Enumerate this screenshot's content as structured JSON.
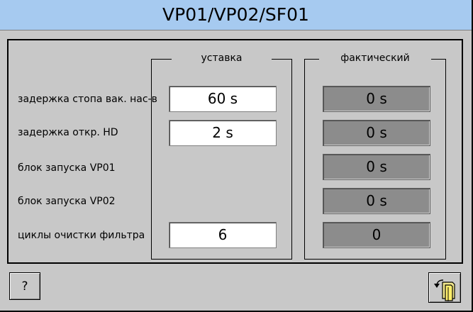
{
  "title": "VP01/VP02/SF01",
  "columns": {
    "setpoint": "уставка",
    "actual": "фактический"
  },
  "rows": [
    {
      "label": "задержка стопа вак. нас-в",
      "setpoint": "60 s",
      "actual": "0 s"
    },
    {
      "label": "задержка откр. HD",
      "setpoint": "2 s",
      "actual": "0 s"
    },
    {
      "label": "блок запуска VP01",
      "setpoint": null,
      "actual": "0 s"
    },
    {
      "label": "блок запуска VP02",
      "setpoint": null,
      "actual": "0 s"
    },
    {
      "label": "циклы очистки фильтра",
      "setpoint": "6",
      "actual": "0"
    }
  ],
  "buttons": {
    "help": "?",
    "back_icon": "back-document-icon"
  },
  "colors": {
    "title_bar": "#a6caf0",
    "background": "#c8c8c8",
    "actual_field": "#8c8c8c"
  }
}
